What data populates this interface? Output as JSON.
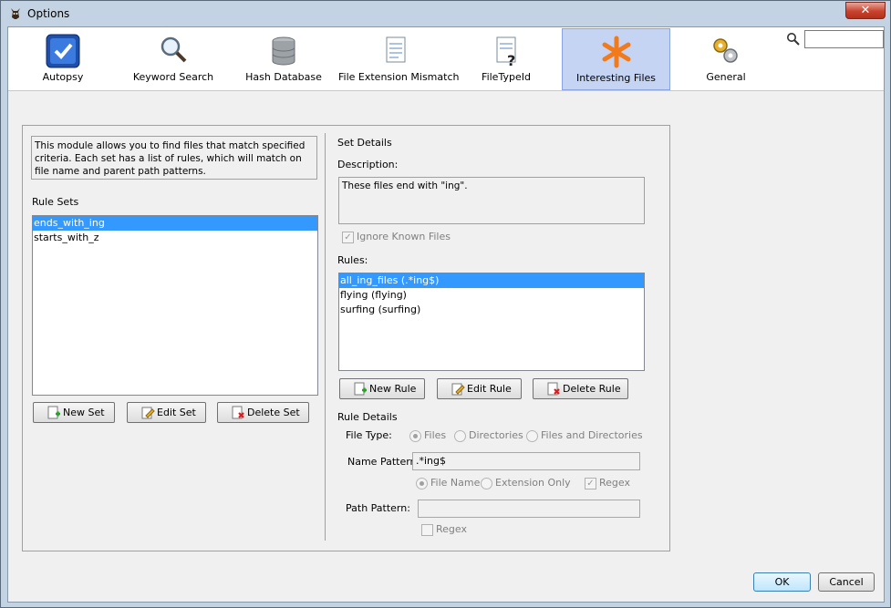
{
  "window": {
    "title": "Options",
    "close_glyph": "✕"
  },
  "toolbar": {
    "tabs": [
      {
        "label": "Autopsy",
        "icon": "autopsy-checkmark-icon"
      },
      {
        "label": "Keyword Search",
        "icon": "magnifier-icon"
      },
      {
        "label": "Hash Database",
        "icon": "database-icon"
      },
      {
        "label": "File Extension Mismatch",
        "icon": "document-icon"
      },
      {
        "label": "FileTypeId",
        "icon": "document-question-icon"
      },
      {
        "label": "Interesting Files",
        "icon": "asterisk-icon",
        "active": true
      },
      {
        "label": "General",
        "icon": "gears-icon"
      }
    ],
    "search": {
      "value": "",
      "placeholder": ""
    }
  },
  "module_description": "This module allows you to find files that match specified criteria. Each set has a list of rules, which will match on file name and parent path patterns.",
  "rule_sets": {
    "label": "Rule Sets",
    "items": [
      "ends_with_ing",
      "starts_with_z"
    ],
    "selected_index": 0,
    "buttons": {
      "new": "New Set",
      "edit": "Edit Set",
      "delete": "Delete Set"
    }
  },
  "set_details": {
    "heading": "Set Details",
    "description_label": "Description:",
    "description_value": "These files end with \"ing\".",
    "ignore_known_files": {
      "label": "Ignore Known Files",
      "checked": true
    }
  },
  "rules": {
    "label": "Rules:",
    "items": [
      "all_ing_files (.*ing$)",
      "flying (flying)",
      "surfing (surfing)"
    ],
    "selected_index": 0,
    "buttons": {
      "new": "New Rule",
      "edit": "Edit Rule",
      "delete": "Delete Rule"
    }
  },
  "rule_details": {
    "heading": "Rule Details",
    "file_type_label": "File Type:",
    "file_type_options": [
      "Files",
      "Directories",
      "Files and Directories"
    ],
    "file_type_selected": "Files",
    "name_pattern_label": "Name Pattern",
    "name_pattern_value": ".*ing$",
    "name_options": [
      "File Name",
      "Extension Only"
    ],
    "name_option_selected": "File Name",
    "name_regex": {
      "label": "Regex",
      "checked": true
    },
    "path_pattern_label": "Path Pattern:",
    "path_pattern_value": "",
    "path_regex": {
      "label": "Regex",
      "checked": false
    }
  },
  "footer": {
    "ok": "OK",
    "cancel": "Cancel"
  },
  "colors": {
    "selection": "#3399ff",
    "active_tab": "#c4d4f2",
    "asterisk": "#f27a1a"
  }
}
